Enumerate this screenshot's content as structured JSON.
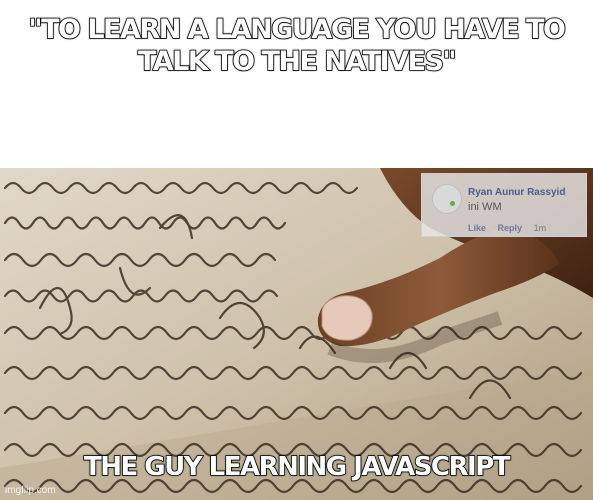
{
  "meme": {
    "top_text": "\"TO LEARN A LANGUAGE YOU HAVE TO TALK TO THE NATIVES\"",
    "bottom_text": "THE GUY LEARNING JAVASCRIPT",
    "watermark": "imgflip.com"
  },
  "comment": {
    "author": "Ryan Aunur Rassyid",
    "text": "ini WM",
    "like_label": "Like",
    "reply_label": "Reply",
    "time": "1m"
  },
  "colors": {
    "caption_fill": "#ffffff",
    "caption_stroke": "#000000",
    "paper": "#d2c6b1",
    "ink": "#3a2e22",
    "skin": "#8a5a3b"
  }
}
